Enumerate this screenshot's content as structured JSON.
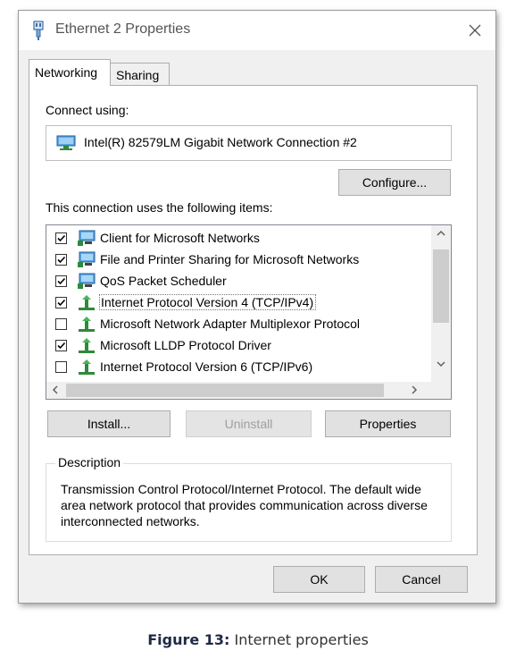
{
  "window": {
    "title": "Ethernet 2 Properties",
    "icon": "ethernet-adapter-icon",
    "close_icon": "close-icon"
  },
  "tabs": [
    {
      "label": "Networking",
      "active": true
    },
    {
      "label": "Sharing",
      "active": false
    }
  ],
  "connect_using": {
    "label": "Connect using:",
    "adapter_name": "Intel(R) 82579LM Gigabit Network Connection #2"
  },
  "buttons": {
    "configure": "Configure...",
    "install": "Install...",
    "uninstall": "Uninstall",
    "properties": "Properties",
    "ok": "OK",
    "cancel": "Cancel"
  },
  "items_label": "This connection uses the following items:",
  "items": [
    {
      "label": "Client for Microsoft Networks",
      "checked": true,
      "icon": "network-client-icon"
    },
    {
      "label": "File and Printer Sharing for Microsoft Networks",
      "checked": true,
      "icon": "network-service-icon"
    },
    {
      "label": "QoS Packet Scheduler",
      "checked": true,
      "icon": "network-service-icon"
    },
    {
      "label": "Internet Protocol Version 4 (TCP/IPv4)",
      "checked": true,
      "icon": "protocol-icon",
      "selected": true
    },
    {
      "label": "Microsoft Network Adapter Multiplexor Protocol",
      "checked": false,
      "icon": "protocol-icon"
    },
    {
      "label": "Microsoft LLDP Protocol Driver",
      "checked": true,
      "icon": "protocol-icon"
    },
    {
      "label": "Internet Protocol Version 6 (TCP/IPv6)",
      "checked": false,
      "icon": "protocol-icon"
    }
  ],
  "description": {
    "title": "Description",
    "text": "Transmission Control Protocol/Internet Protocol. The default wide area network protocol that provides communication across diverse interconnected networks."
  },
  "caption": {
    "label": "Figure 13:",
    "text": "Internet properties"
  }
}
